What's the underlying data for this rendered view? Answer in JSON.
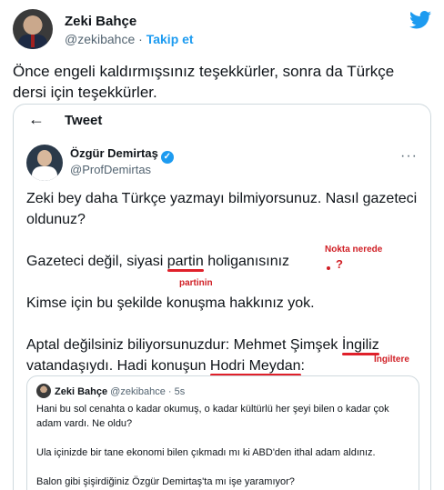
{
  "author": {
    "name": "Zeki Bahçe",
    "handle": "@zekibahce",
    "separator": "·",
    "follow_label": "Takip et"
  },
  "tweet_text": "Önce engeli kaldırmışsınız teşekkürler, sonra da Türkçe dersi için teşekkürler.",
  "embed": {
    "title": "Tweet",
    "back_icon": "←",
    "author_name": "Özgür Demirtaş",
    "author_handle": "@ProfDemirtas",
    "more_icon": "···",
    "verified_icon": "✓",
    "paragraphs": {
      "p1": "Zeki bey daha Türkçe yazmayı bilmiyorsunuz. Nasıl gazeteci oldunuz?",
      "p2_a": "Gazeteci değil, siyasi ",
      "p2_u": "partin",
      "p2_b": " holiganısınız",
      "p3": "Kimse için bu şekilde konuşma hakkınız yok.",
      "p4_a": "Aptal değilsiniz biliyorsunuzdur: Mehmet Şimşek ",
      "p4_u1": "İngiliz",
      "p4_b": " vatandaşıydı. Hadi konuşun ",
      "p4_u2": "Hodri Meydan",
      "p4_c": ":"
    },
    "annotations": {
      "nokta": "Nokta nerede",
      "qmark": "?",
      "partinin": "partinin",
      "ingiltere": "İngiltere"
    },
    "quote": {
      "author_name": "Zeki Bahçe",
      "author_handle": "@zekibahce",
      "time": "· 5s",
      "lines": [
        "Hani bu sol cenahta o kadar okumuş, o kadar kültürlü her şeyi bilen o kadar çok adam vardı. Ne oldu?",
        "Ula içinizde bir tane ekonomi bilen çıkmadı mı ki ABD'den ithal adam aldınız.",
        "Balon gibi şişirdiğiniz Özgür Demirtaş'ta mı işe yaramıyor?"
      ]
    }
  },
  "colors": {
    "twitter_blue": "#1d9bf0",
    "annotation_red": "#d01f25",
    "text": "#0f1419",
    "muted": "#536471"
  }
}
